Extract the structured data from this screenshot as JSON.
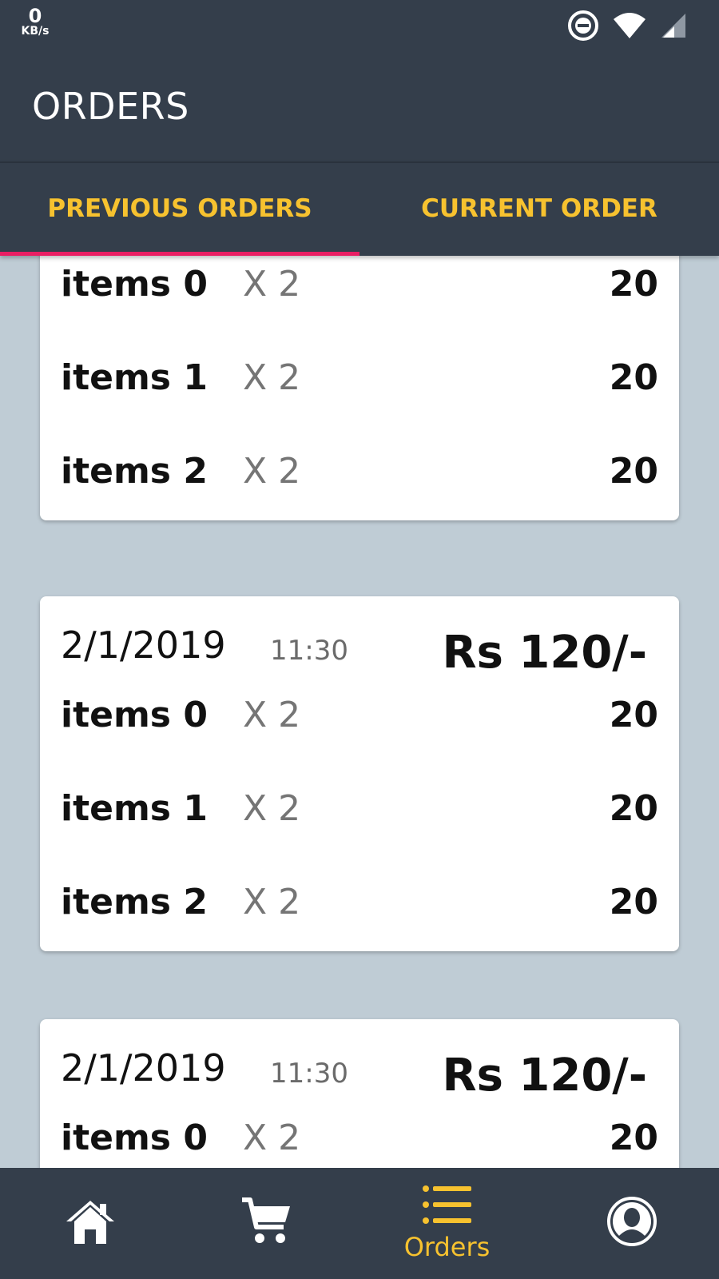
{
  "status_bar": {
    "net_speed_value": "0",
    "net_speed_unit": "KB/s",
    "icons": [
      "do-not-disturb-icon",
      "wifi-icon",
      "signal-icon"
    ]
  },
  "app_bar": {
    "title": "ORDERS"
  },
  "tabs": [
    {
      "label": "PREVIOUS ORDERS",
      "selected": true
    },
    {
      "label": "CURRENT ORDER",
      "selected": false
    }
  ],
  "colors": {
    "primary": "#343e4b",
    "accent": "#f7c22f",
    "tab_indicator": "#e91e63",
    "background": "#bfccd5"
  },
  "orders": [
    {
      "date": "",
      "time": "",
      "total": "",
      "items": [
        {
          "name": "items 0",
          "qty": "X 2",
          "price": "20"
        },
        {
          "name": "items 1",
          "qty": "X 2",
          "price": "20"
        },
        {
          "name": "items 2",
          "qty": "X 2",
          "price": "20"
        }
      ]
    },
    {
      "date": "2/1/2019",
      "time": "11:30",
      "total": "Rs 120/-",
      "items": [
        {
          "name": "items 0",
          "qty": "X 2",
          "price": "20"
        },
        {
          "name": "items 1",
          "qty": "X 2",
          "price": "20"
        },
        {
          "name": "items 2",
          "qty": "X 2",
          "price": "20"
        }
      ]
    },
    {
      "date": "2/1/2019",
      "time": "11:30",
      "total": "Rs 120/-",
      "items": [
        {
          "name": "items 0",
          "qty": "X 2",
          "price": "20"
        }
      ]
    }
  ],
  "bottom_nav": [
    {
      "icon": "home-icon",
      "label": "",
      "active": false
    },
    {
      "icon": "cart-icon",
      "label": "",
      "active": false
    },
    {
      "icon": "orders-list-icon",
      "label": "Orders",
      "active": true
    },
    {
      "icon": "profile-icon",
      "label": "",
      "active": false
    }
  ]
}
